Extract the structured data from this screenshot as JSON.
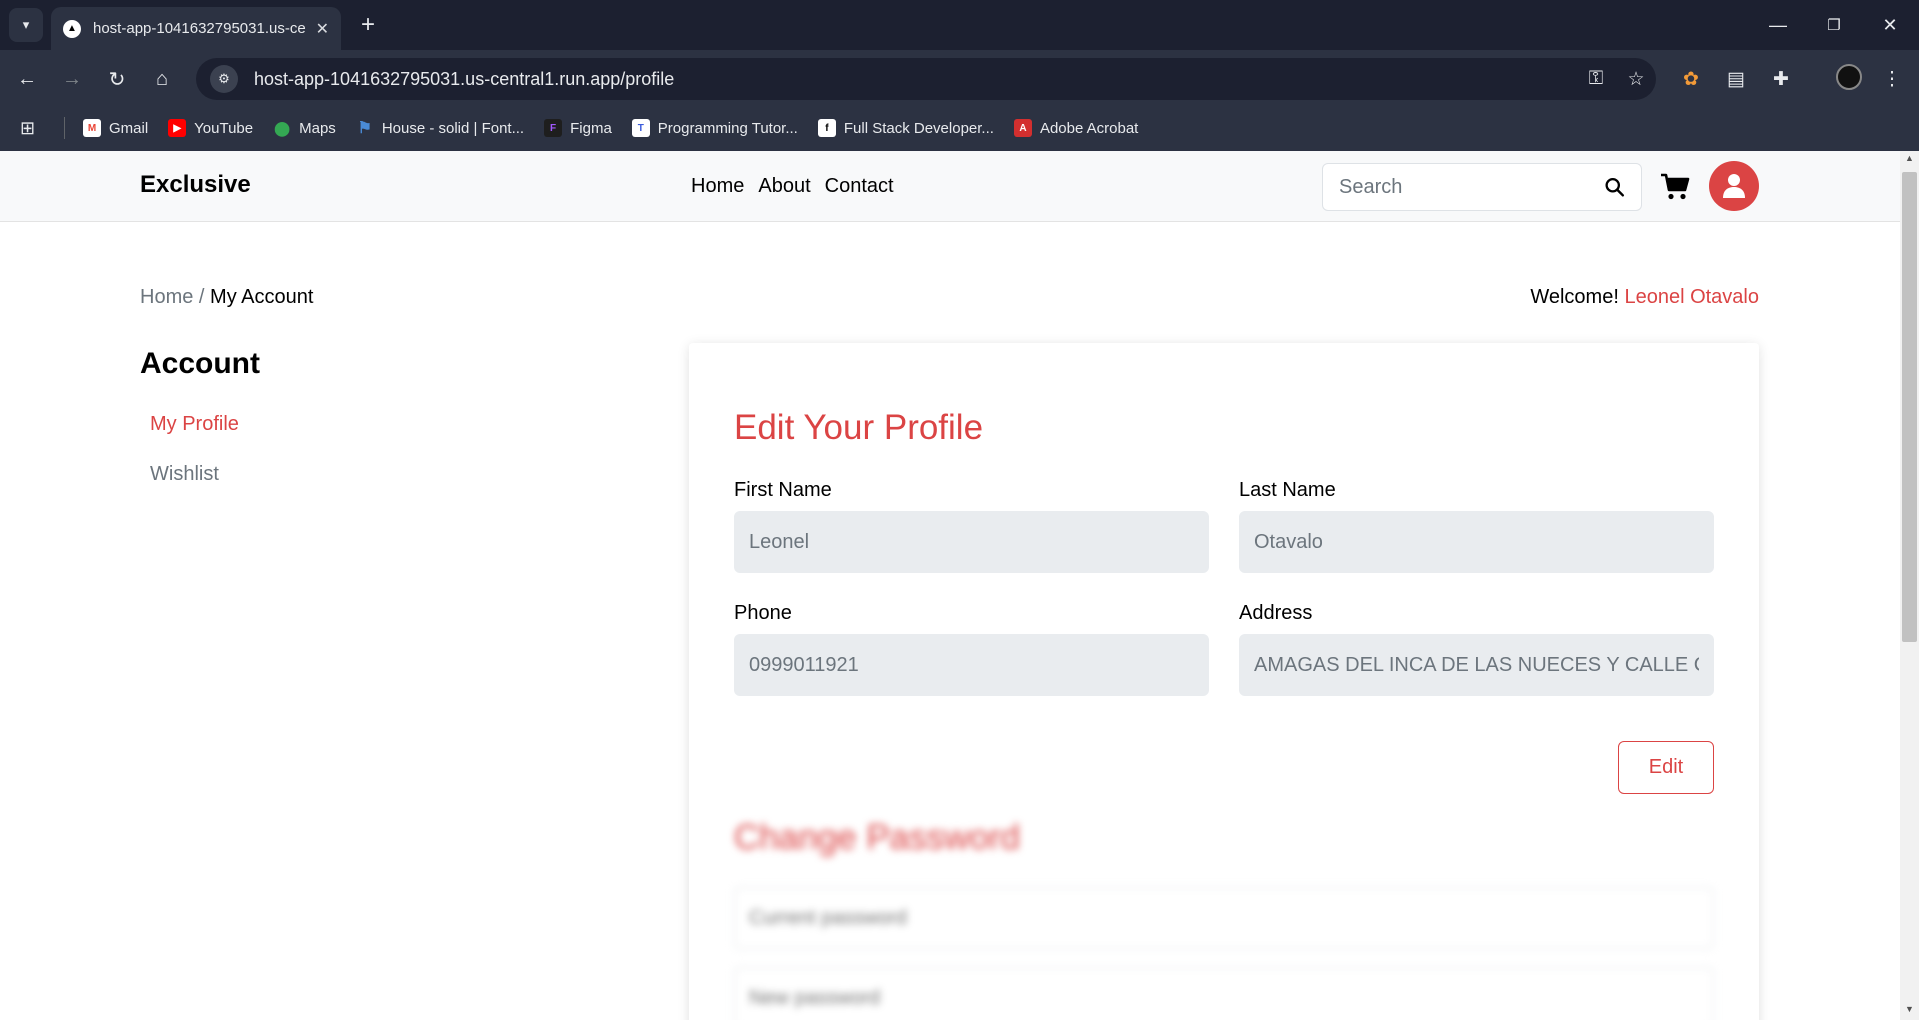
{
  "browser": {
    "tab_title": "host-app-1041632795031.us-ce",
    "url": "host-app-1041632795031.us-central1.run.app/profile",
    "bookmarks": [
      {
        "label": "Gmail",
        "color": "#ea4335",
        "glyph": "M"
      },
      {
        "label": "YouTube",
        "color": "#ff0000",
        "glyph": "▶"
      },
      {
        "label": "Maps",
        "color": "#34a853",
        "glyph": "⬤"
      },
      {
        "label": "House - solid | Font...",
        "color": "#4a8bd6",
        "glyph": "⚑"
      },
      {
        "label": "Figma",
        "color": "#a259ff",
        "glyph": "F"
      },
      {
        "label": "Programming Tutor...",
        "color": "#3b5bdb",
        "glyph": "T"
      },
      {
        "label": "Full Stack Developer...",
        "color": "#000000",
        "glyph": "f"
      },
      {
        "label": "Adobe Acrobat",
        "color": "#d32f2f",
        "glyph": "A"
      }
    ]
  },
  "header": {
    "brand": "Exclusive",
    "nav": [
      "Home",
      "About",
      "Contact"
    ],
    "search_placeholder": "Search",
    "accent_color": "#db4444"
  },
  "breadcrumb": {
    "home": "Home",
    "separator": "/",
    "current": "My Account"
  },
  "welcome": {
    "prefix": "Welcome!",
    "name": "Leonel Otavalo"
  },
  "sidebar": {
    "title": "Account",
    "items": [
      {
        "label": "My Profile",
        "active": true
      },
      {
        "label": "Wishlist",
        "active": false
      }
    ]
  },
  "profile": {
    "title": "Edit Your Profile",
    "fields": {
      "first_name": {
        "label": "First Name",
        "value": "Leonel"
      },
      "last_name": {
        "label": "Last Name",
        "value": "Otavalo"
      },
      "phone": {
        "label": "Phone",
        "value": "0999011921"
      },
      "address": {
        "label": "Address",
        "value": "AMAGAS DEL INCA DE LAS NUECES Y CALLE C"
      }
    },
    "edit_button": "Edit"
  },
  "password": {
    "title": "Change Password",
    "current_placeholder": "Current password",
    "new_placeholder": "New password"
  }
}
